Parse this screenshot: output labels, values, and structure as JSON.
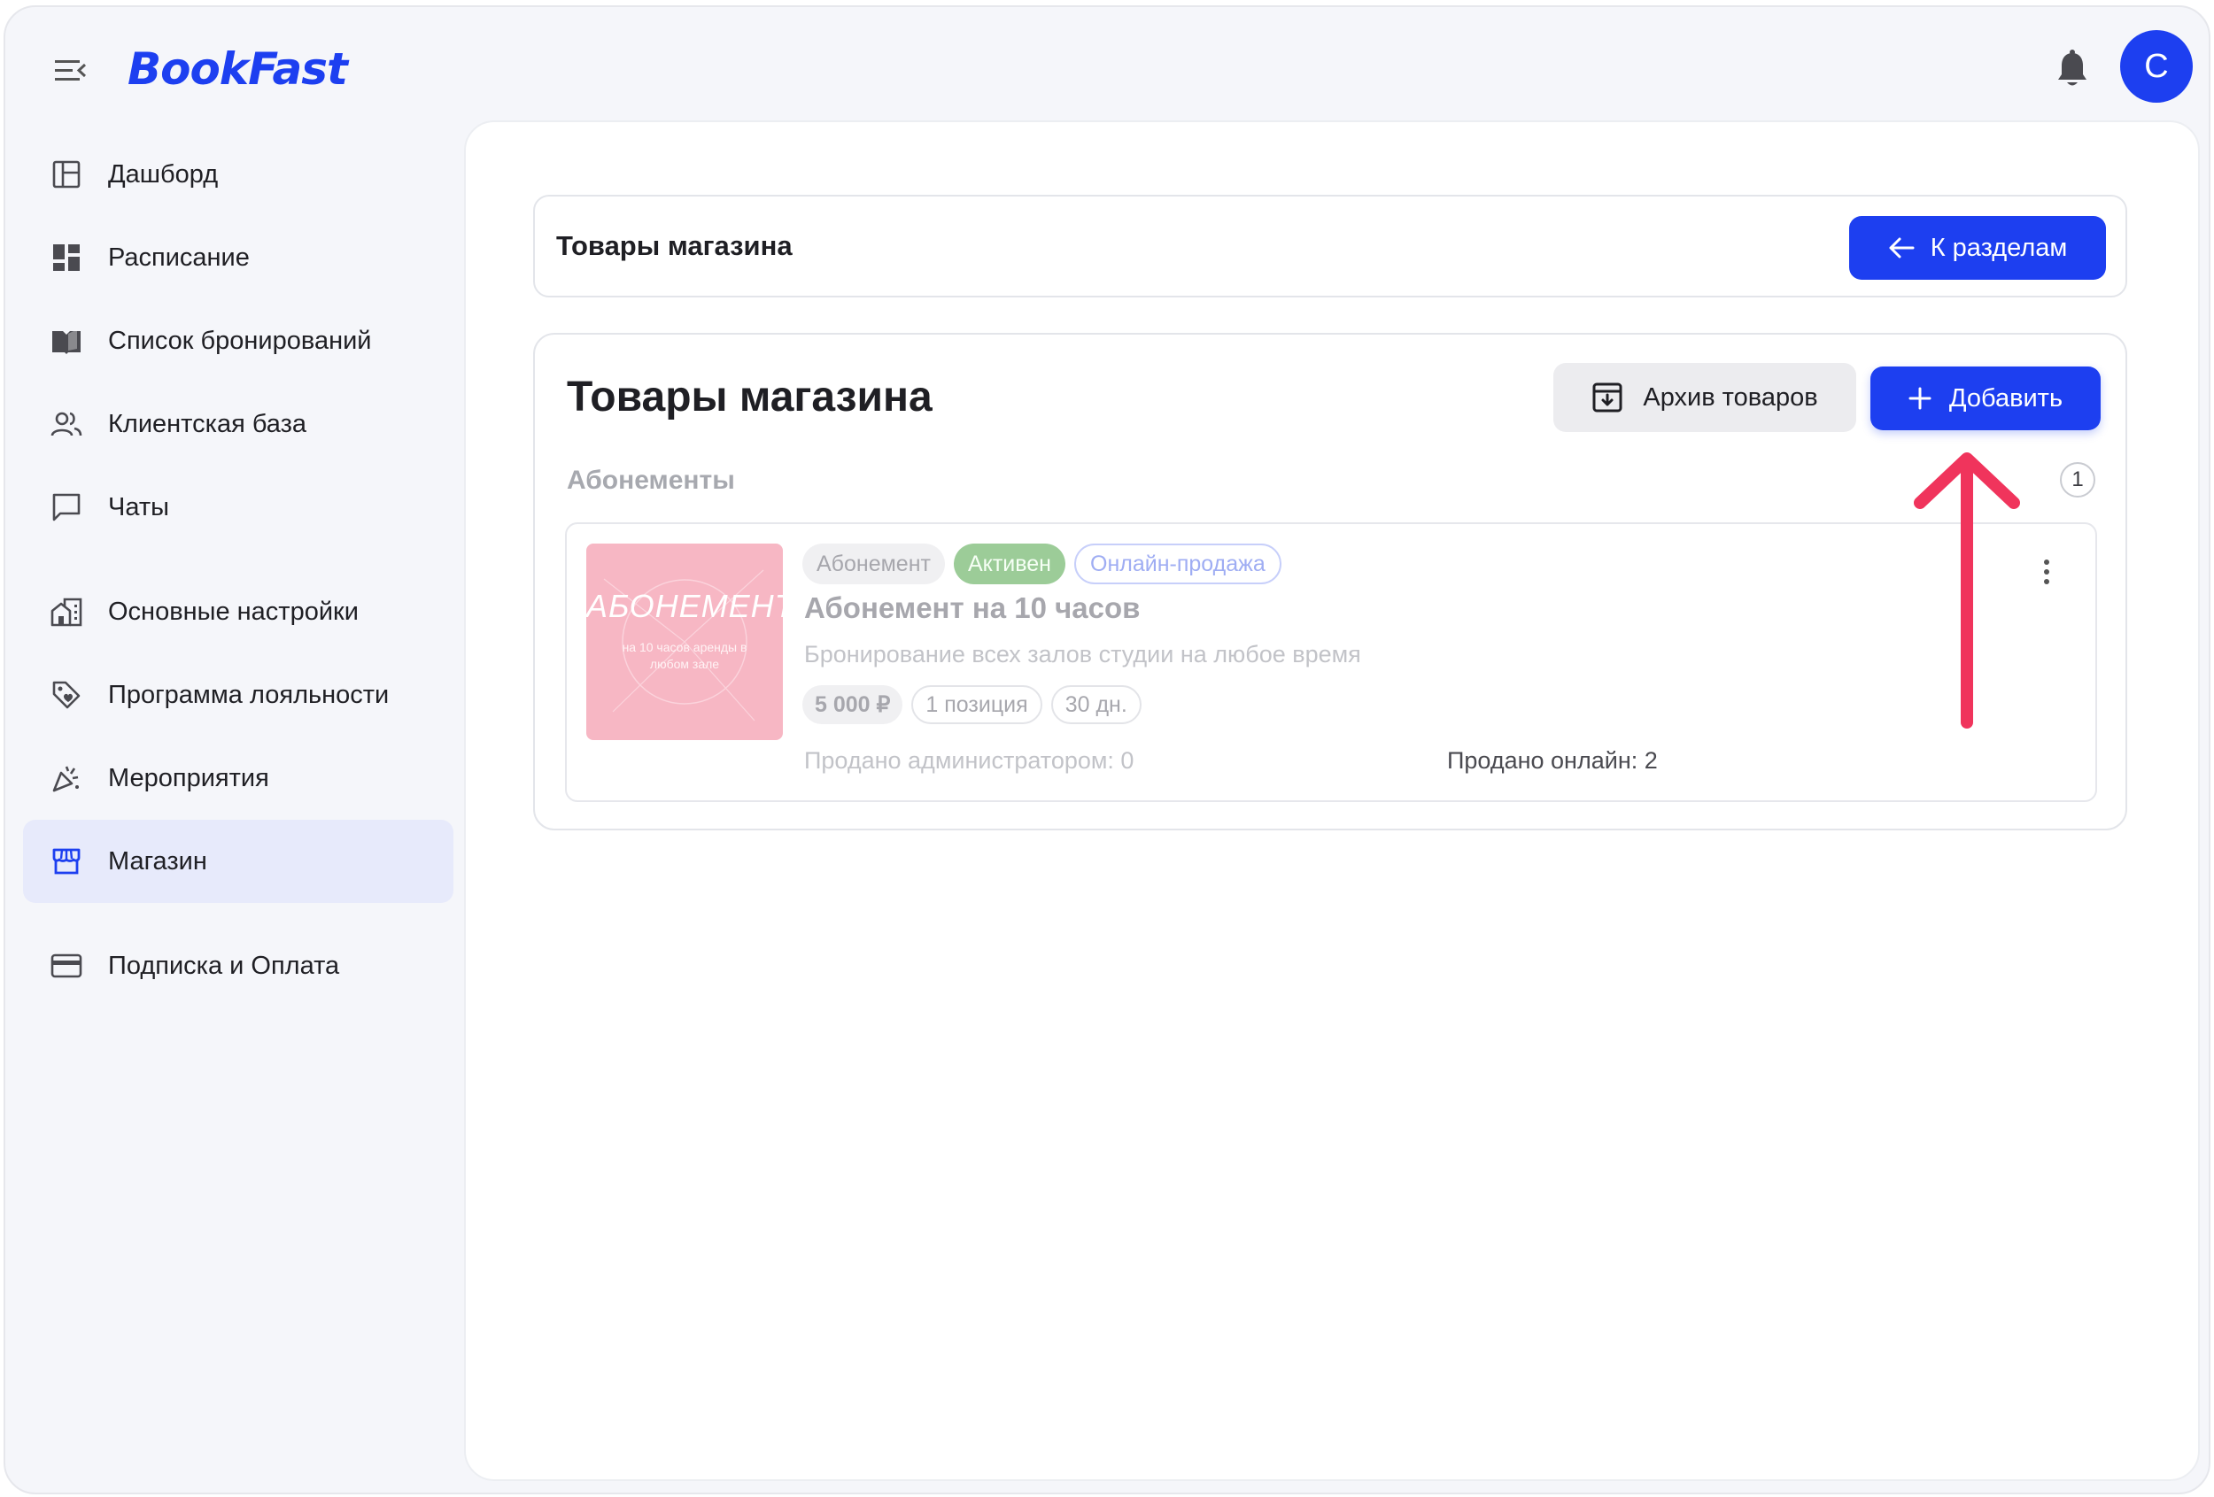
{
  "header": {
    "logo": "BookFast",
    "avatar_letter": "C"
  },
  "sidebar": {
    "items": [
      {
        "label": "Дашборд",
        "icon": "dashboard-icon"
      },
      {
        "label": "Расписание",
        "icon": "schedule-icon"
      },
      {
        "label": "Список бронирований",
        "icon": "bookings-icon"
      },
      {
        "label": "Клиентская база",
        "icon": "clients-icon"
      },
      {
        "label": "Чаты",
        "icon": "chat-icon"
      },
      {
        "label": "Основные настройки",
        "icon": "settings-building-icon"
      },
      {
        "label": "Программа лояльности",
        "icon": "loyalty-tag-icon"
      },
      {
        "label": "Мероприятия",
        "icon": "party-icon"
      },
      {
        "label": "Магазин",
        "icon": "store-icon",
        "active": true
      },
      {
        "label": "Подписка и Оплата",
        "icon": "credit-card-icon"
      }
    ]
  },
  "topbar": {
    "title": "Товары магазина",
    "back_label": "К разделам"
  },
  "main": {
    "title": "Товары магазина",
    "archive_label": "Архив товаров",
    "add_label": "Добавить",
    "section": {
      "label": "Абонементы",
      "count": "1"
    },
    "product": {
      "image_title": "АБОНЕМЕНТ",
      "image_subtitle": "на 10 часов аренды в любом зале",
      "tags": [
        "Абонемент",
        "Активен",
        "Онлайн-продажа"
      ],
      "name": "Абонемент на 10 часов",
      "description": "Бронирование всех залов студии на любое время",
      "price": "5 000 ₽",
      "positions": "1 позиция",
      "duration": "30 дн.",
      "sold_admin": "Продано администратором: 0",
      "sold_online": "Продано онлайн: 2"
    }
  },
  "colors": {
    "accent": "#1d3ff0",
    "active_bg": "#e7eafb",
    "tag_active": "#9ccc98",
    "thumb_pink": "#f7b7c4",
    "annotation_arrow": "#f0345c"
  }
}
